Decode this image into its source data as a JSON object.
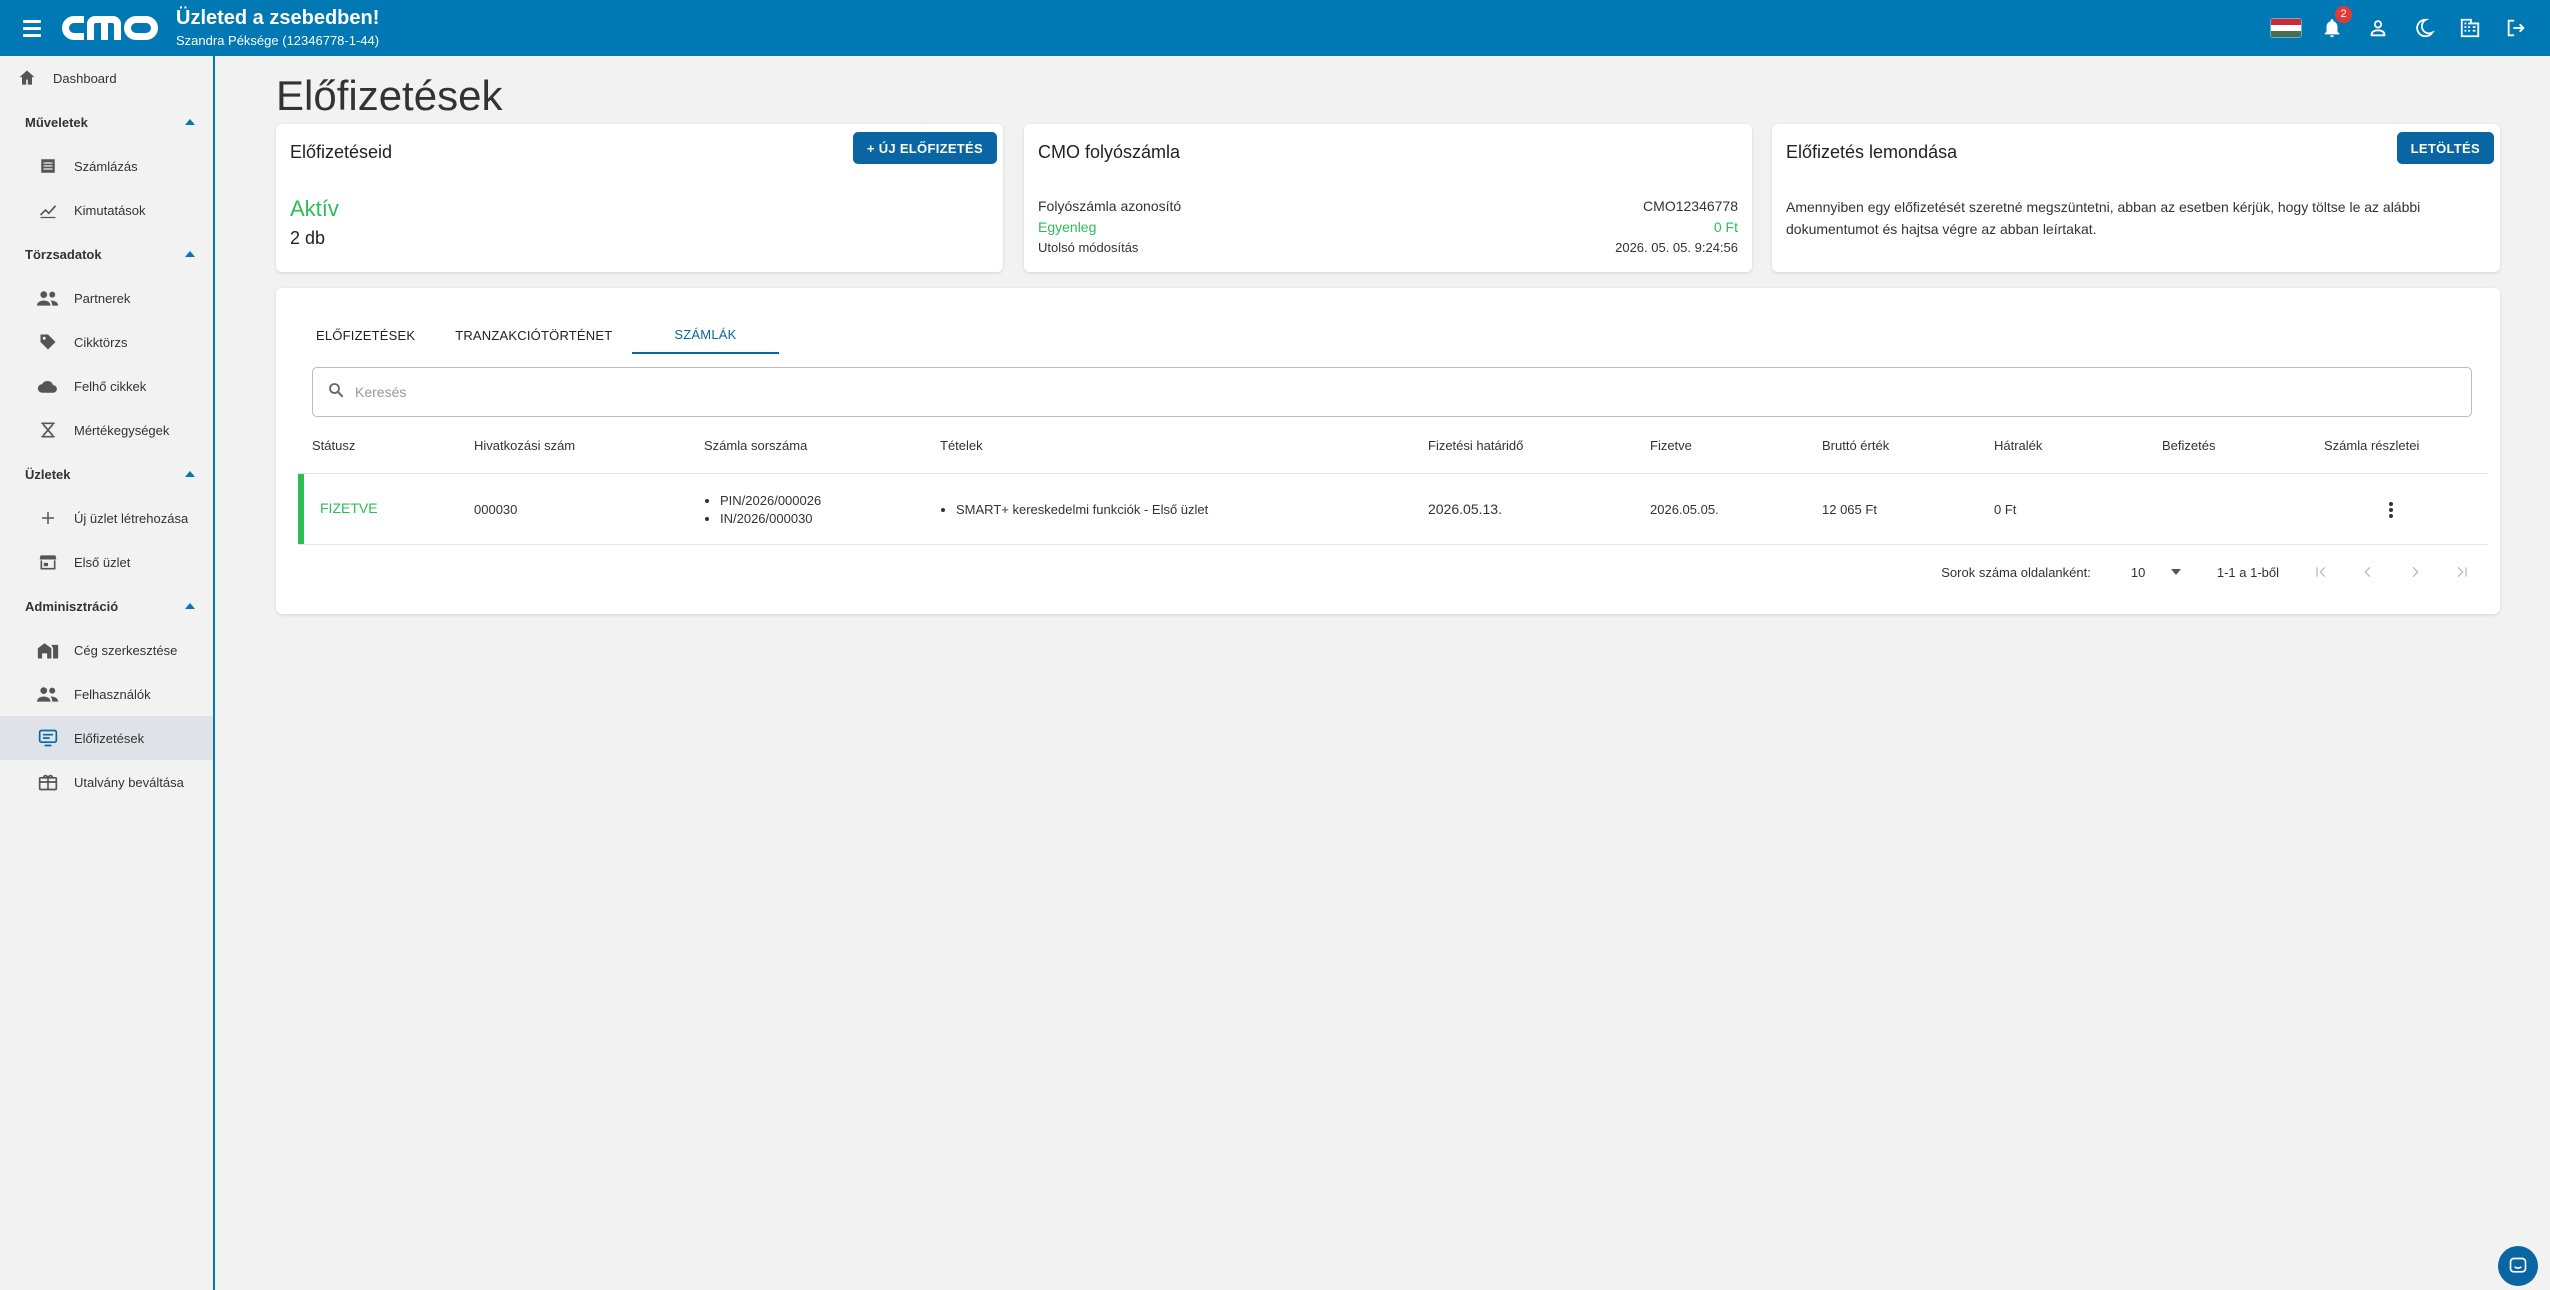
{
  "header": {
    "title": "Üzleted a zsebedben!",
    "subtitle": "Szandra Péksége (12346778-1-44)",
    "notification_count": "2"
  },
  "sidebar": {
    "dashboard": "Dashboard",
    "sections": [
      {
        "label": "Műveletek",
        "items": [
          "Számlázás",
          "Kimutatások"
        ]
      },
      {
        "label": "Törzsadatok",
        "items": [
          "Partnerek",
          "Cikktörzs",
          "Felhő cikkek",
          "Mértékegységek"
        ]
      },
      {
        "label": "Üzletek",
        "items": [
          "Új üzlet létrehozása",
          "Első üzlet"
        ]
      },
      {
        "label": "Adminisztráció",
        "items": [
          "Cég szerkesztése",
          "Felhasználók",
          "Előfizetések",
          "Utalvány beváltása"
        ]
      }
    ]
  },
  "page": {
    "title": "Előfizetések"
  },
  "subscriptions_card": {
    "title": "Előfizetéseid",
    "new_button": "+ ÚJ ELŐFIZETÉS",
    "status": "Aktív",
    "count": "2 db"
  },
  "account_card": {
    "title": "CMO folyószámla",
    "id_label": "Folyószámla azonosító",
    "id_value": "CMO12346778",
    "balance_label": "Egyenleg",
    "balance_value": "0 Ft",
    "modified_label": "Utolsó módosítás",
    "modified_value": "2026. 05. 05. 9:24:56"
  },
  "cancel_card": {
    "title": "Előfizetés lemondása",
    "download_button": "LETÖLTÉS",
    "text": "Amennyiben egy előfizetését szeretné megszüntetni, abban az esetben kérjük, hogy töltse le az alábbi dokumentumot és hajtsa végre az abban leírtakat."
  },
  "tabs": [
    "ELŐFIZETÉSEK",
    "TRANZAKCIÓTÖRTÉNET",
    "SZÁMLÁK"
  ],
  "search": {
    "placeholder": "Keresés"
  },
  "table": {
    "columns": [
      "Státusz",
      "Hivatkozási szám",
      "Számla sorszáma",
      "Tételek",
      "Fizetési határidő",
      "Fizetve",
      "Bruttó érték",
      "Hátralék",
      "Befizetés",
      "Számla részletei"
    ],
    "rows": [
      {
        "status": "FIZETVE",
        "reference": "000030",
        "invoice_numbers": [
          "PIN/2026/000026",
          "IN/2026/000030"
        ],
        "items": [
          "SMART+ kereskedelmi funkciók - Első üzlet"
        ],
        "due_date": "2026.05.13.",
        "paid": "2026.05.05.",
        "gross": "12 065 Ft",
        "arrears": "0 Ft",
        "payment": ""
      }
    ]
  },
  "pagination": {
    "rows_label": "Sorok száma oldalanként:",
    "rows_value": "10",
    "range": "1-1 a 1-ből"
  },
  "colors": {
    "primary": "#0078b4",
    "success": "#2dbd55"
  }
}
